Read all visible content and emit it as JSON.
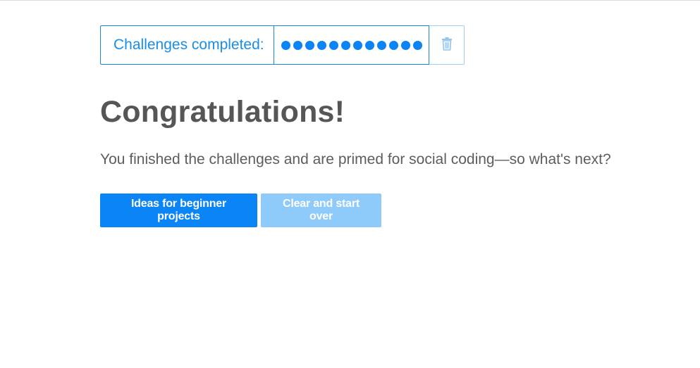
{
  "progress": {
    "label": "Challenges completed:",
    "completed_count": 12,
    "trash_icon": "trash-icon"
  },
  "main": {
    "heading": "Congratulations!",
    "lead": "You finished the challenges and are primed for social coding—so what's next?"
  },
  "actions": {
    "primary_label": "Ideas for beginner projects",
    "secondary_label": "Clear and start over"
  },
  "colors": {
    "accent": "#0b84f5",
    "accent_light": "#8ecbfb",
    "text": "#565656"
  }
}
